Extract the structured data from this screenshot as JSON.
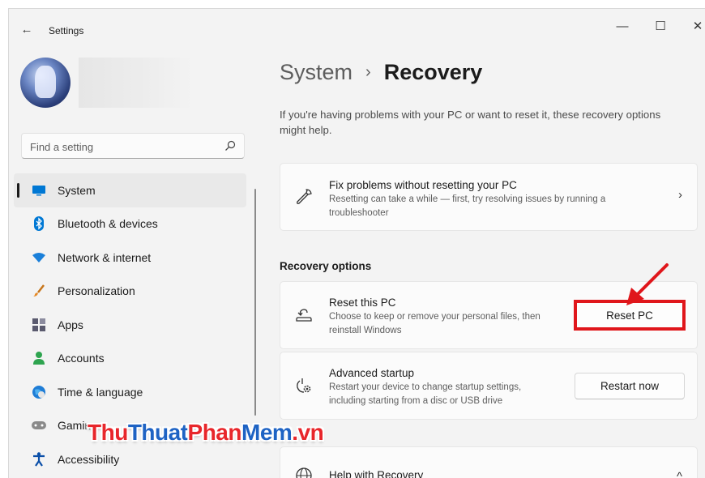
{
  "window": {
    "title": "Settings",
    "back_glyph": "←",
    "minimize_glyph": "—",
    "maximize_glyph": "☐",
    "close_glyph": "✕"
  },
  "sidebar": {
    "search_placeholder": "Find a setting",
    "items": [
      {
        "label": "System",
        "icon": "monitor-icon",
        "selected": true
      },
      {
        "label": "Bluetooth & devices",
        "icon": "bluetooth-icon"
      },
      {
        "label": "Network & internet",
        "icon": "wifi-icon"
      },
      {
        "label": "Personalization",
        "icon": "brush-icon"
      },
      {
        "label": "Apps",
        "icon": "apps-icon"
      },
      {
        "label": "Accounts",
        "icon": "person-icon"
      },
      {
        "label": "Time & language",
        "icon": "globe-clock-icon"
      },
      {
        "label": "Gaming",
        "icon": "gamepad-icon"
      },
      {
        "label": "Accessibility",
        "icon": "accessibility-icon"
      }
    ]
  },
  "main": {
    "breadcrumb_parent": "System",
    "breadcrumb_sep": "›",
    "breadcrumb_current": "Recovery",
    "intro": "If you're having problems with your PC or want to reset it, these recovery options might help.",
    "fix_card": {
      "title": "Fix problems without resetting your PC",
      "desc": "Resetting can take a while — first, try resolving issues by running a troubleshooter",
      "chevron": "›"
    },
    "section_heading": "Recovery options",
    "reset_card": {
      "title": "Reset this PC",
      "desc": "Choose to keep or remove your personal files, then reinstall Windows",
      "button": "Reset PC"
    },
    "advanced_card": {
      "title": "Advanced startup",
      "desc": "Restart your device to change startup settings, including starting from a disc or USB drive",
      "button": "Restart now"
    },
    "help_card": {
      "title": "Help with Recovery",
      "chevron": "^"
    }
  },
  "watermark": {
    "part1": "Thu",
    "part2": "Thuat",
    "part3": "Phan",
    "part4": "Mem",
    "part5": ".vn"
  },
  "colors": {
    "accent": "#0067c0",
    "annotation_red": "#e0161b",
    "watermark_red": "#e8262b",
    "watermark_blue": "#1e63c4"
  }
}
